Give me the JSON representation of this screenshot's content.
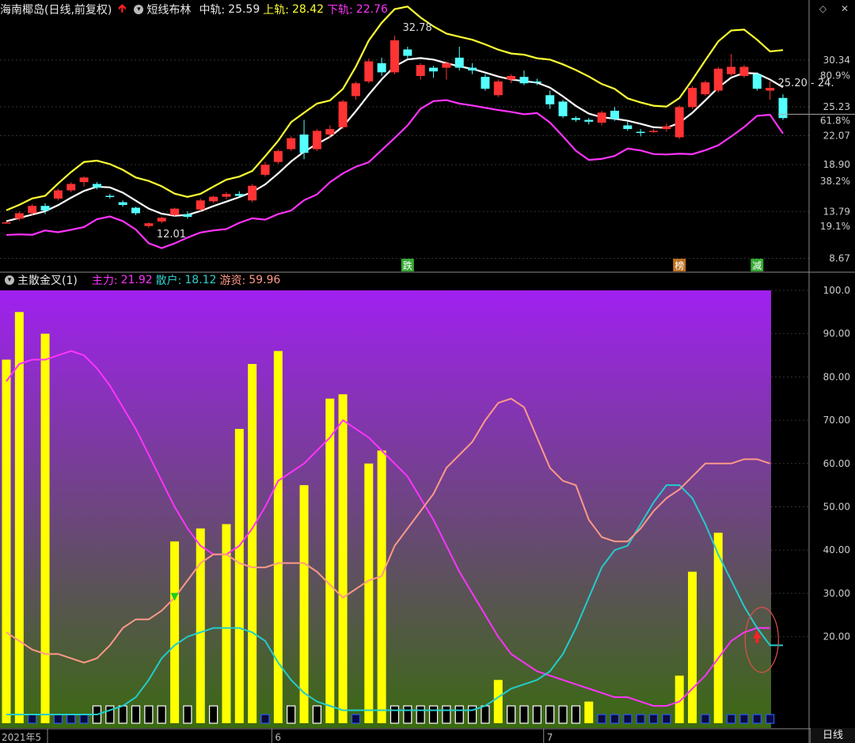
{
  "top_header": {
    "stock": "海南椰岛(日线,前复权)",
    "indicator": "短线布林",
    "mid_label": "中轨: ",
    "mid_value": "25.59",
    "upper_label": "上轨: ",
    "upper_value": "28.42",
    "lower_label": "下轨: ",
    "lower_value": "22.76"
  },
  "bottom_header": {
    "indicator": "主散金叉(1)",
    "main_label": "主力: ",
    "main_value": "21.92",
    "retail_label": "散户: ",
    "retail_value": "18.12",
    "hot_label": "游资: ",
    "hot_value": "59.96"
  },
  "footer_label": "日线",
  "colors": {
    "up_candle": "#ff3333",
    "down_candle": "#55ffff",
    "upper_band": "#ffff33",
    "mid_band": "#ffffff",
    "lower_band": "#ff33ff",
    "main_line": "#ff33ff",
    "retail_line": "#22cccc",
    "hot_line": "#ff9988",
    "volume_bar": "#ffff00",
    "bottom_bg_top": "#a020f0",
    "bottom_bg_bottom": "#3a6a10"
  },
  "chart_data": [
    {
      "type": "candlestick",
      "title": "短线布林",
      "y_ticks": [
        "30.34",
        "25.23",
        "22.07",
        "18.90",
        "13.79",
        "8.67"
      ],
      "y_pct_ticks": [
        "80.9%",
        "61.8%",
        "38.2%",
        "19.1%"
      ],
      "ylim": [
        7.5,
        35
      ],
      "annotations": [
        {
          "text": "32.78",
          "index": 30
        },
        {
          "text": "12.01",
          "index": 11
        },
        {
          "text": "25.20 - 24.",
          "index": 59
        }
      ],
      "markers": [
        {
          "text": "跌",
          "index": 31
        },
        {
          "text": "榜",
          "index": 52
        },
        {
          "text": "减",
          "index": 58
        }
      ],
      "candles": [
        [
          12.6,
          12.7,
          12.5,
          12.6
        ],
        [
          13.0,
          13.8,
          12.8,
          13.6
        ],
        [
          13.6,
          14.6,
          13.4,
          14.4
        ],
        [
          14.4,
          14.7,
          13.5,
          13.9
        ],
        [
          15.2,
          16.3,
          15.0,
          16.1
        ],
        [
          16.1,
          17.0,
          15.9,
          16.8
        ],
        [
          17.0,
          17.6,
          16.5,
          17.5
        ],
        [
          16.8,
          17.0,
          16.2,
          16.4
        ],
        [
          15.5,
          15.7,
          15.2,
          15.4
        ],
        [
          14.8,
          15.0,
          14.3,
          14.5
        ],
        [
          14.2,
          14.3,
          13.4,
          13.6
        ],
        [
          12.2,
          12.6,
          12.0,
          12.5
        ],
        [
          12.7,
          13.2,
          12.5,
          13.1
        ],
        [
          13.4,
          14.2,
          13.3,
          14.1
        ],
        [
          13.5,
          13.8,
          13.0,
          13.2
        ],
        [
          14.0,
          15.2,
          13.8,
          15.0
        ],
        [
          14.9,
          15.5,
          14.7,
          15.4
        ],
        [
          15.4,
          15.9,
          15.1,
          15.7
        ],
        [
          15.7,
          16.0,
          15.4,
          15.5
        ],
        [
          15.0,
          16.8,
          14.8,
          16.6
        ],
        [
          17.8,
          19.2,
          17.6,
          18.9
        ],
        [
          19.2,
          20.6,
          19.0,
          20.4
        ],
        [
          20.6,
          22.0,
          20.4,
          21.8
        ],
        [
          22.2,
          23.8,
          19.5,
          20.2
        ],
        [
          20.6,
          22.8,
          20.4,
          22.6
        ],
        [
          22.2,
          23.2,
          21.8,
          22.8
        ],
        [
          23.0,
          26.0,
          22.8,
          25.8
        ],
        [
          26.4,
          28.0,
          26.0,
          27.8
        ],
        [
          28.0,
          30.5,
          27.8,
          30.2
        ],
        [
          30.0,
          30.6,
          28.6,
          29.0
        ],
        [
          29.0,
          33.0,
          28.8,
          32.5
        ],
        [
          31.5,
          31.8,
          30.5,
          30.8
        ],
        [
          28.6,
          30.0,
          28.2,
          29.8
        ],
        [
          29.5,
          29.7,
          28.4,
          29.1
        ],
        [
          29.5,
          30.2,
          28.2,
          30.0
        ],
        [
          30.6,
          31.8,
          29.2,
          29.5
        ],
        [
          29.5,
          30.0,
          28.8,
          29.2
        ],
        [
          28.5,
          28.8,
          27.0,
          27.2
        ],
        [
          26.5,
          28.2,
          26.3,
          28.0
        ],
        [
          28.2,
          28.8,
          27.8,
          28.6
        ],
        [
          28.5,
          29.2,
          27.6,
          27.8
        ],
        [
          28.0,
          28.3,
          27.6,
          27.9
        ],
        [
          26.5,
          27.0,
          25.0,
          25.5
        ],
        [
          25.8,
          26.0,
          24.0,
          24.2
        ],
        [
          24.0,
          24.2,
          23.6,
          23.8
        ],
        [
          23.8,
          24.0,
          23.3,
          23.6
        ],
        [
          23.5,
          24.8,
          23.2,
          24.6
        ],
        [
          24.8,
          25.2,
          23.7,
          23.9
        ],
        [
          23.2,
          23.6,
          22.6,
          22.8
        ],
        [
          22.5,
          22.8,
          22.0,
          22.4
        ],
        [
          22.5,
          22.8,
          22.4,
          22.6
        ],
        [
          22.8,
          23.4,
          22.5,
          23.1
        ],
        [
          21.9,
          25.4,
          21.7,
          25.2
        ],
        [
          25.2,
          27.5,
          25.0,
          27.3
        ],
        [
          26.6,
          28.1,
          26.4,
          27.9
        ],
        [
          27.0,
          29.6,
          26.8,
          29.4
        ],
        [
          28.8,
          31.0,
          28.6,
          29.6
        ],
        [
          28.6,
          29.8,
          28.4,
          29.6
        ],
        [
          28.8,
          29.0,
          27.0,
          27.2
        ],
        [
          27.0,
          28.0,
          26.0,
          27.3
        ],
        [
          26.2,
          26.6,
          23.8,
          24.0
        ]
      ]
    },
    {
      "type": "line",
      "title": "主散金叉(1)",
      "y_ticks": [
        "100.0",
        "90.00",
        "80.00",
        "70.00",
        "60.00",
        "50.00",
        "40.00",
        "30.00",
        "20.00"
      ],
      "ylim": [
        0,
        100
      ],
      "x_tick_labels": [
        {
          "text": "2021年5",
          "index": 0
        },
        {
          "text": "6",
          "index": 21
        },
        {
          "text": "7",
          "index": 42
        }
      ],
      "series": [
        {
          "name": "主力",
          "values": [
            79,
            83,
            84,
            84,
            85,
            86,
            85,
            82,
            78,
            73,
            68,
            62,
            56,
            50,
            45,
            41,
            39,
            39,
            41,
            45,
            50,
            56,
            58,
            60,
            63,
            66,
            70,
            68,
            66,
            63,
            60,
            57,
            52,
            47,
            41,
            35,
            30,
            25,
            20,
            16,
            14,
            12,
            11,
            10,
            9,
            8,
            7,
            6,
            6,
            5,
            4,
            4,
            5,
            8,
            11,
            15,
            19,
            21,
            22,
            22
          ]
        },
        {
          "name": "散户",
          "values": [
            2,
            2,
            2,
            2,
            2,
            2,
            2,
            2,
            3,
            4,
            6,
            10,
            15,
            18,
            20,
            21,
            22,
            22,
            22,
            21,
            19,
            14,
            10,
            7,
            5,
            4,
            3,
            3,
            3,
            3,
            3,
            3,
            3,
            3,
            3,
            3,
            3,
            4,
            6,
            8,
            9,
            10,
            12,
            16,
            22,
            29,
            36,
            40,
            41,
            46,
            51,
            55,
            55,
            52,
            46,
            39,
            33,
            27,
            22,
            18,
            18
          ]
        },
        {
          "name": "游资",
          "values": [
            21,
            19,
            17,
            16,
            16,
            15,
            14,
            15,
            18,
            22,
            24,
            24,
            26,
            29,
            33,
            37,
            39,
            39,
            37,
            36,
            36,
            37,
            37,
            37,
            35,
            32,
            29,
            31,
            33,
            34,
            41,
            45,
            49,
            53,
            59,
            62,
            65,
            70,
            74,
            75,
            73,
            66,
            59,
            56,
            55,
            47,
            43,
            42,
            42,
            45,
            49,
            52,
            54,
            57,
            60,
            60,
            60,
            61,
            61,
            60
          ]
        }
      ],
      "bars": [
        84,
        95,
        2,
        90,
        2,
        2,
        2,
        2,
        2,
        2,
        2,
        2,
        2,
        42,
        2,
        45,
        2,
        46,
        68,
        83,
        2,
        86,
        2,
        55,
        2,
        75,
        76,
        2,
        60,
        63,
        2,
        2,
        2,
        2,
        2,
        2,
        2,
        2,
        10,
        2,
        2,
        2,
        2,
        2,
        2,
        5,
        2,
        2,
        2,
        2,
        2,
        2,
        11,
        35,
        2,
        44,
        2,
        2,
        2,
        2
      ],
      "bar_style": [
        "y",
        "y",
        "n",
        "y",
        "n",
        "n",
        "n",
        "w",
        "w",
        "w",
        "w",
        "w",
        "w",
        "y",
        "w",
        "y",
        "w",
        "y",
        "y",
        "y",
        "n",
        "y",
        "w",
        "y",
        "w",
        "y",
        "y",
        "n",
        "y",
        "y",
        "w",
        "w",
        "w",
        "w",
        "w",
        "w",
        "w",
        "w",
        "y",
        "w",
        "w",
        "w",
        "w",
        "w",
        "w",
        "y",
        "n",
        "n",
        "n",
        "n",
        "n",
        "n",
        "y",
        "y",
        "n",
        "y",
        "n",
        "n",
        "n",
        "n"
      ],
      "markers": [
        {
          "type": "down-arrow",
          "index": 13,
          "value": 29,
          "color": "#22cc22"
        },
        {
          "type": "up-arrow",
          "index": 58,
          "value": 20,
          "color": "#ff2020"
        }
      ]
    }
  ]
}
